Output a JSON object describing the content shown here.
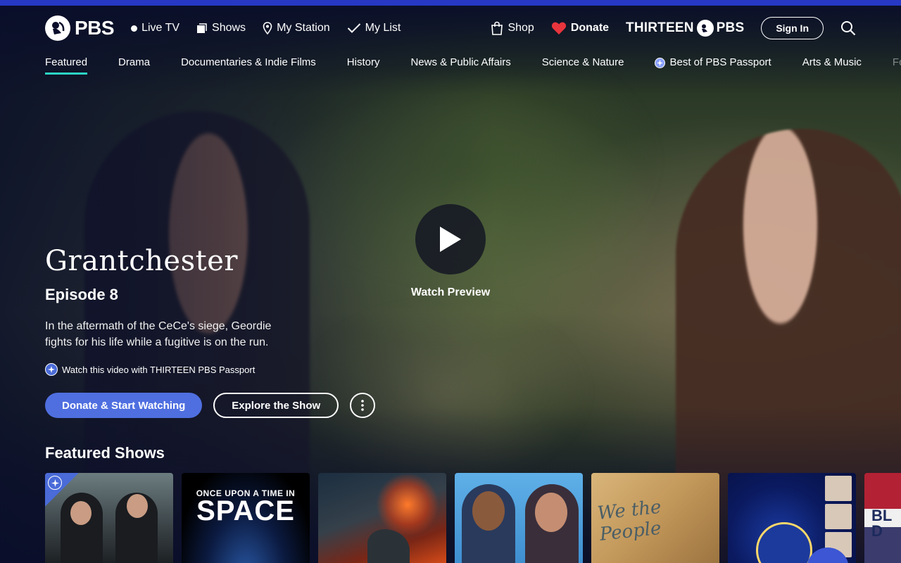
{
  "header": {
    "logo_text": "PBS",
    "nav": {
      "live_tv": "Live TV",
      "shows": "Shows",
      "my_station": "My Station",
      "my_list": "My List"
    },
    "shop": "Shop",
    "donate": "Donate",
    "station_name": "THIRTEEN",
    "station_suffix": "PBS",
    "sign_in": "Sign In"
  },
  "categories": [
    "Featured",
    "Drama",
    "Documentaries & Indie Films",
    "History",
    "News & Public Affairs",
    "Science & Nature",
    "Best of PBS Passport",
    "Arts & Music",
    "Food"
  ],
  "hero": {
    "show_title": "Grantchester",
    "episode": "Episode 8",
    "description": "In the aftermath of the CeCe's siege, Geordie fights for his life while a fugitive is on the run.",
    "passport_note": "Watch this video with THIRTEEN PBS Passport",
    "watch_preview": "Watch Preview",
    "donate_button": "Donate & Start Watching",
    "explore_button": "Explore the Show"
  },
  "featured_shows": {
    "title": "Featured Shows",
    "card_2_line1": "ONCE UPON A TIME IN",
    "card_2_line2": "SPACE",
    "card_5_text": "We the People",
    "card_7_text": "BL D"
  },
  "colors": {
    "accent_bar": "#2638c4",
    "tab_underline": "#2bd4c4",
    "primary_button": "#4f6fe0",
    "background": "#0a0e2a"
  }
}
